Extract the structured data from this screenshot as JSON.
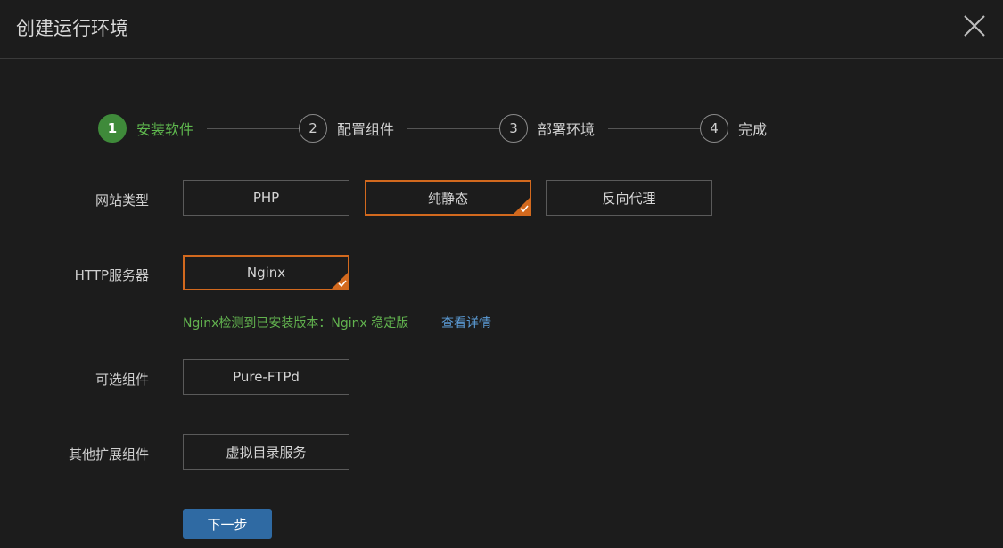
{
  "dialog": {
    "title": "创建运行环境",
    "close_icon": "close-icon"
  },
  "steps": [
    {
      "number": "1",
      "label": "安装软件",
      "active": true
    },
    {
      "number": "2",
      "label": "配置组件",
      "active": false
    },
    {
      "number": "3",
      "label": "部署环境",
      "active": false
    },
    {
      "number": "4",
      "label": "完成",
      "active": false
    }
  ],
  "site_type": {
    "label": "网站类型",
    "options": [
      "PHP",
      "纯静态",
      "反向代理"
    ],
    "selected": "纯静态"
  },
  "http_server": {
    "label": "HTTP服务器",
    "options": [
      "Nginx"
    ],
    "selected": "Nginx",
    "hint": "Nginx检测到已安装版本：Nginx 稳定版",
    "detail_link": "查看详情"
  },
  "optional_components": {
    "label": "可选组件",
    "options": [
      "Pure-FTPd"
    ]
  },
  "other_components": {
    "label": "其他扩展组件",
    "options": [
      "虚拟目录服务"
    ]
  },
  "next_button": "下一步",
  "colors": {
    "background": "#1c1c1c",
    "active_step": "#3f8a3a",
    "active_text": "#5fb84e",
    "selected_border": "#d2691e",
    "primary_button": "#2f6aa3",
    "link": "#5b9bd5"
  }
}
